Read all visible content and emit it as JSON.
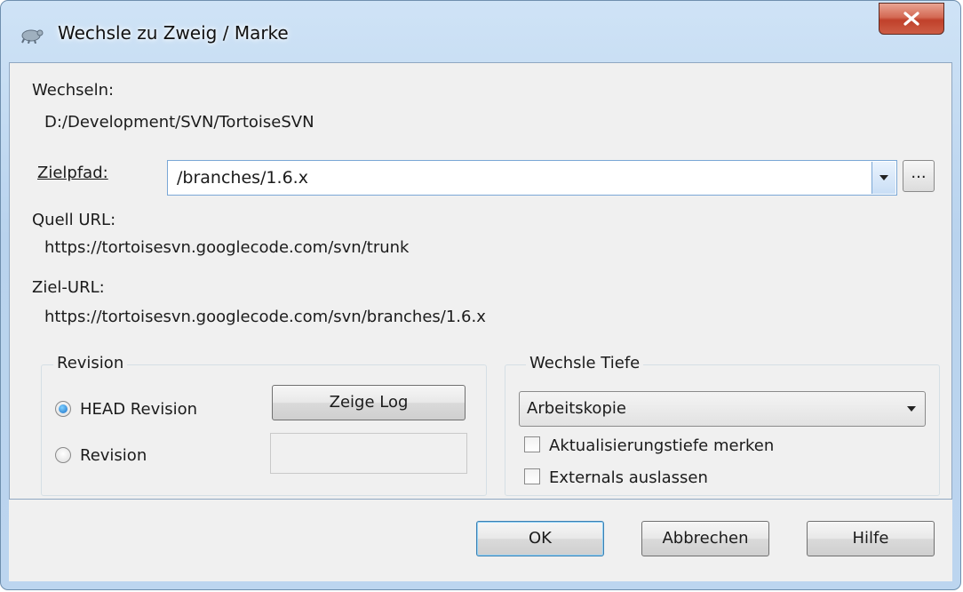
{
  "window": {
    "title": "Wechsle zu Zweig / Marke",
    "close_icon": "close-icon",
    "app_icon": "tortoise-icon"
  },
  "switch": {
    "label": "Wechseln:",
    "path": "D:/Development/SVN/TortoiseSVN"
  },
  "target": {
    "label": "Zielpfad:",
    "value": "/branches/1.6.x",
    "browse_label": "..."
  },
  "source_url": {
    "label": "Quell URL:",
    "value": "https://tortoisesvn.googlecode.com/svn/trunk"
  },
  "target_url": {
    "label": "Ziel-URL:",
    "value": "https://tortoisesvn.googlecode.com/svn/branches/1.6.x"
  },
  "revision_group": {
    "title": "Revision",
    "head_label": "HEAD Revision",
    "revision_label": "Revision",
    "selected": "HEAD Revision",
    "show_log_label": "Zeige Log",
    "revision_value": ""
  },
  "depth_group": {
    "title": "Wechsle Tiefe",
    "selected": "Arbeitskopie",
    "remember_depth_label": "Aktualisierungstiefe merken",
    "remember_depth_checked": false,
    "omit_externals_label": "Externals auslassen",
    "omit_externals_checked": false
  },
  "buttons": {
    "ok": "OK",
    "cancel": "Abbrechen",
    "help": "Hilfe"
  },
  "colors": {
    "titlebar": "#bcd5ef",
    "close_button": "#c0402a",
    "dialog_bg": "#f0f0f0"
  }
}
